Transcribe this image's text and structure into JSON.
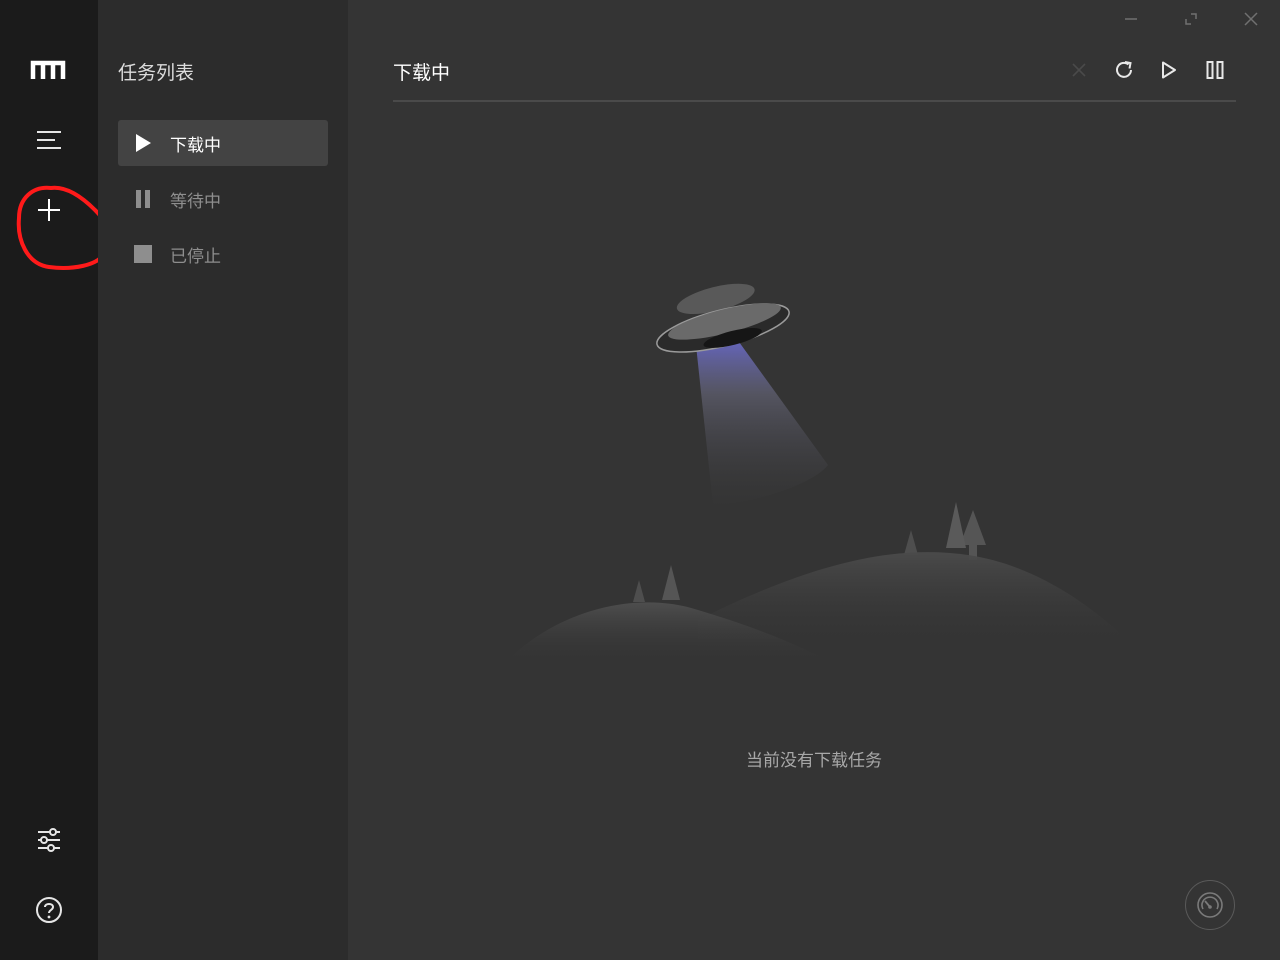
{
  "rail": {
    "logo_icon": "motrix-logo-icon",
    "menu_icon": "menu-icon",
    "add_icon": "plus-icon",
    "settings_icon": "sliders-icon",
    "help_icon": "question-circle-icon"
  },
  "task_panel": {
    "title": "任务列表",
    "items": [
      {
        "label": "下载中",
        "icon": "play-icon",
        "active": true
      },
      {
        "label": "等待中",
        "icon": "pause-icon",
        "active": false
      },
      {
        "label": "已停止",
        "icon": "stop-icon",
        "active": false
      }
    ]
  },
  "main": {
    "title": "下载中",
    "toolbar": {
      "delete_icon": "close-icon",
      "refresh_icon": "refresh-icon",
      "resume_all_icon": "play-outline-icon",
      "pause_all_icon": "pause-outline-icon"
    },
    "empty_message": "当前没有下载任务",
    "speed_icon": "speedometer-icon"
  },
  "window_controls": [
    "minimize-icon",
    "restore-icon",
    "close-icon"
  ],
  "colors": {
    "rail_bg": "#1b1b1b",
    "panel_bg": "#2c2c2c",
    "main_bg": "#343434",
    "active_item_bg": "#434343",
    "annotation": "#ff1a1a"
  }
}
